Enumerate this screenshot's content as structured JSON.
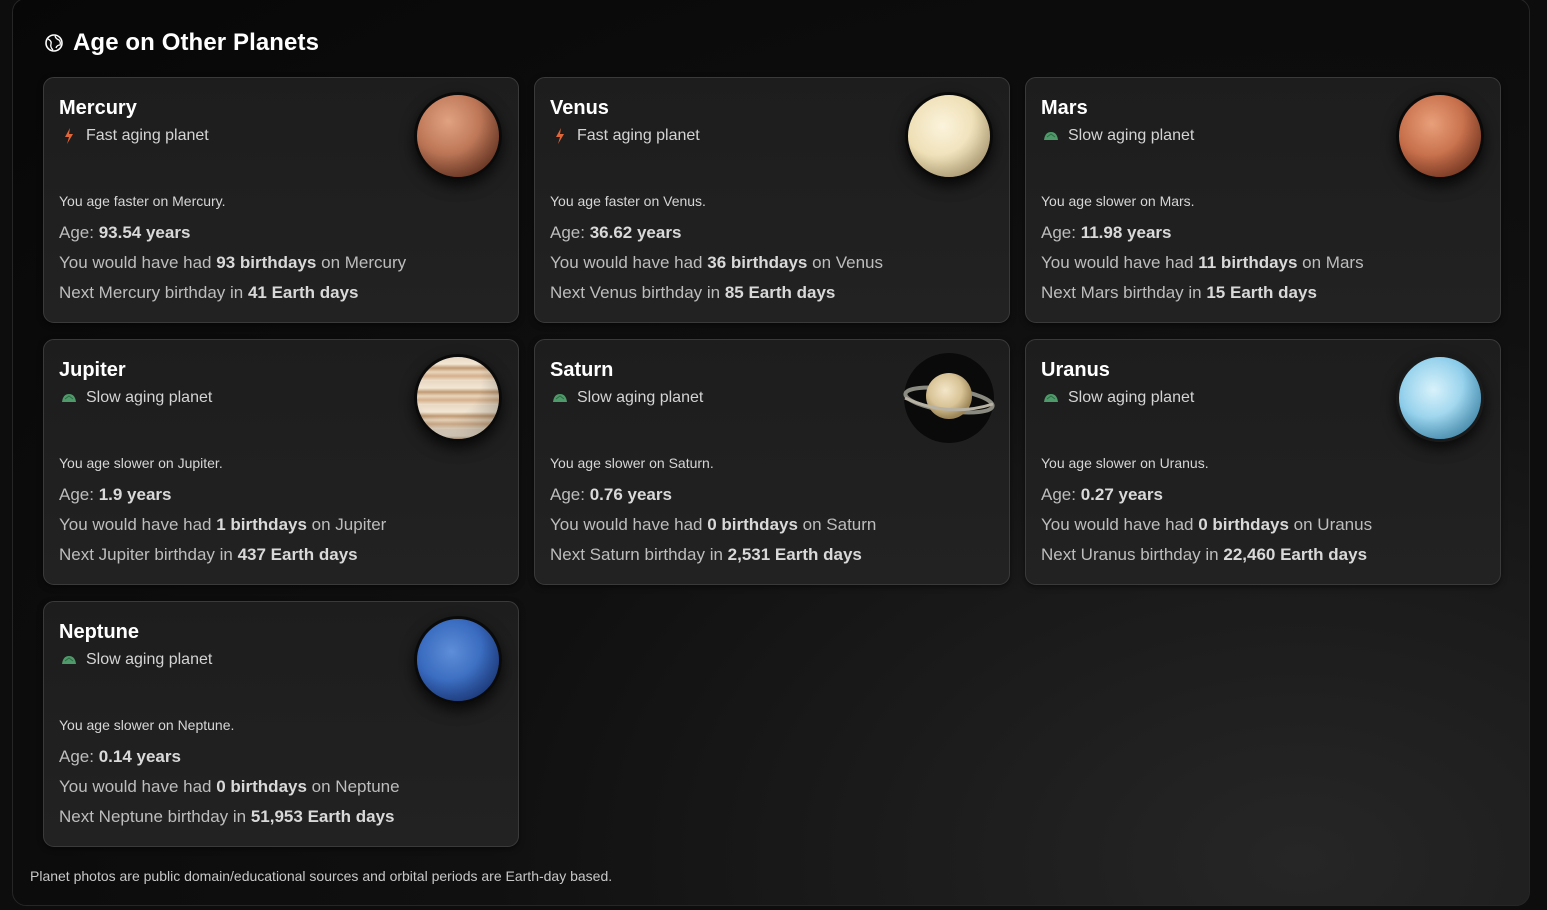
{
  "header": {
    "title": "Age on Other Planets",
    "icon": "globe-icon"
  },
  "planets": [
    {
      "name": "Mercury",
      "tag": "Fast aging planet",
      "tag_icon": "lightning-icon",
      "desc": "You age faster on Mercury.",
      "age_label": "Age: ",
      "age": "93.54 years",
      "bd_prefix": "You would have had ",
      "bd_count": "93 birthdays",
      "bd_suffix": " on Mercury",
      "next_prefix": "Next Mercury birthday in ",
      "next_days": "41 Earth days",
      "photo": "mercury-photo"
    },
    {
      "name": "Venus",
      "tag": "Fast aging planet",
      "tag_icon": "lightning-icon",
      "desc": "You age faster on Venus.",
      "age_label": "Age: ",
      "age": "36.62 years",
      "bd_prefix": "You would have had ",
      "bd_count": "36 birthdays",
      "bd_suffix": " on Venus",
      "next_prefix": "Next Venus birthday in ",
      "next_days": "85 Earth days",
      "photo": "venus-photo"
    },
    {
      "name": "Mars",
      "tag": "Slow aging planet",
      "tag_icon": "turtle-icon",
      "desc": "You age slower on Mars.",
      "age_label": "Age: ",
      "age": "11.98 years",
      "bd_prefix": "You would have had ",
      "bd_count": "11 birthdays",
      "bd_suffix": " on Mars",
      "next_prefix": "Next Mars birthday in ",
      "next_days": "15 Earth days",
      "photo": "mars-photo"
    },
    {
      "name": "Jupiter",
      "tag": "Slow aging planet",
      "tag_icon": "turtle-icon",
      "desc": "You age slower on Jupiter.",
      "age_label": "Age: ",
      "age": "1.9 years",
      "bd_prefix": "You would have had ",
      "bd_count": "1 birthdays",
      "bd_suffix": " on Jupiter",
      "next_prefix": "Next Jupiter birthday in ",
      "next_days": "437 Earth days",
      "photo": "jupiter-photo"
    },
    {
      "name": "Saturn",
      "tag": "Slow aging planet",
      "tag_icon": "turtle-icon",
      "desc": "You age slower on Saturn.",
      "age_label": "Age: ",
      "age": "0.76 years",
      "bd_prefix": "You would have had ",
      "bd_count": "0 birthdays",
      "bd_suffix": " on Saturn",
      "next_prefix": "Next Saturn birthday in ",
      "next_days": "2,531 Earth days",
      "photo": "saturn-photo"
    },
    {
      "name": "Uranus",
      "tag": "Slow aging planet",
      "tag_icon": "turtle-icon",
      "desc": "You age slower on Uranus.",
      "age_label": "Age: ",
      "age": "0.27 years",
      "bd_prefix": "You would have had ",
      "bd_count": "0 birthdays",
      "bd_suffix": " on Uranus",
      "next_prefix": "Next Uranus birthday in ",
      "next_days": "22,460 Earth days",
      "photo": "uranus-photo"
    },
    {
      "name": "Neptune",
      "tag": "Slow aging planet",
      "tag_icon": "turtle-icon",
      "desc": "You age slower on Neptune.",
      "age_label": "Age: ",
      "age": "0.14 years",
      "bd_prefix": "You would have had ",
      "bd_count": "0 birthdays",
      "bd_suffix": " on Neptune",
      "next_prefix": "Next Neptune birthday in ",
      "next_days": "51,953 Earth days",
      "photo": "neptune-photo"
    }
  ],
  "footer": {
    "note": "Planet photos are public domain/educational sources and orbital periods are Earth-day based."
  },
  "colors": {
    "background": "#0d0d0d",
    "card": "#1f1f1f",
    "fast_icon": "#e0663a",
    "slow_icon": "#4f9a6a"
  }
}
